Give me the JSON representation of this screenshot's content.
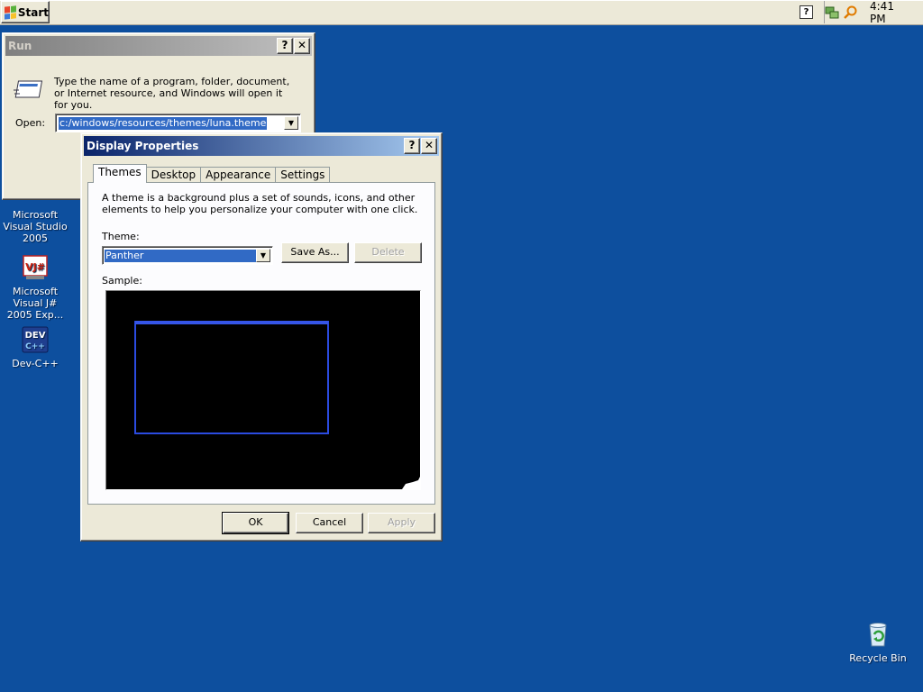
{
  "taskbar": {
    "start_label": "Start",
    "help_glyph": "?",
    "clock": "4:41 PM",
    "tray_icons": [
      "network-icon",
      "search-icon"
    ]
  },
  "desktop_icons": [
    {
      "label": "Microsoft Visual Studio 2005",
      "icon": "visual-studio-icon"
    },
    {
      "label": "Microsoft Visual J# 2005 Exp...",
      "icon": "vjsharp-icon"
    },
    {
      "label": "Dev-C++",
      "icon": "devcpp-icon"
    },
    {
      "label": "Recycle Bin",
      "icon": "recycle-bin-icon"
    }
  ],
  "vj_badge": "VJ#",
  "dev_badge": "DEV",
  "dev_plus": "C++",
  "run": {
    "title": "Run",
    "help_glyph": "?",
    "close_glyph": "✕",
    "description": "Type the name of a program, folder, document, or Internet resource, and Windows will open it for you.",
    "open_label": "Open:",
    "open_value": "c:/windows/resources/themes/luna.theme"
  },
  "display": {
    "title": "Display Properties",
    "help_glyph": "?",
    "close_glyph": "✕",
    "tabs": [
      "Themes",
      "Desktop",
      "Appearance",
      "Settings"
    ],
    "description": "A theme is a background plus a set of sounds, icons, and other elements to help you personalize your computer with one click.",
    "theme_label": "Theme:",
    "theme_value": "Panther",
    "save_as_label": "Save As...",
    "delete_label": "Delete",
    "sample_label": "Sample:",
    "ok_label": "OK",
    "cancel_label": "Cancel",
    "apply_label": "Apply"
  },
  "colors": {
    "desktop": "#0d4f9e",
    "title_active": "#0a246a",
    "selection": "#316ac5"
  }
}
